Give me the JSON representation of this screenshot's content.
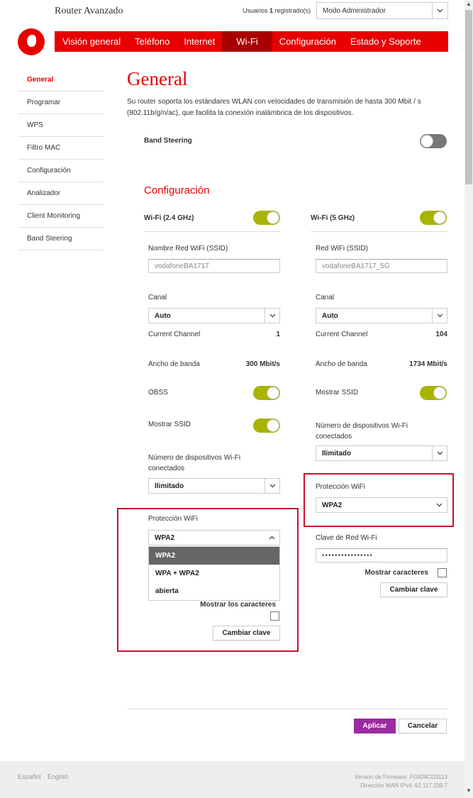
{
  "header": {
    "app_title": "Router Avanzado",
    "users_prefix": "Usuarios ",
    "users_count": "1",
    "users_suffix": " registrado(s)",
    "mode_select": "Modo Administrador"
  },
  "nav": {
    "items": [
      "Visión general",
      "Teléfono",
      "Internet",
      "Wi-Fi",
      "Configuración",
      "Estado y Soporte"
    ],
    "active_index": 3
  },
  "sidebar": {
    "items": [
      "General",
      "Programar",
      "WPS",
      "Filtro MAC",
      "Configuración",
      "Analizador",
      "Client Monitoring",
      "Band Steering"
    ],
    "active_index": 0
  },
  "main": {
    "title": "General",
    "intro": "Su router soporta los estándares WLAN con velocidades de transmisión de hasta 300 Mbit / s (802.11b/g/n/ac), que facilita la conexión inalámbrica de los dispositivos.",
    "band_steering": {
      "label": "Band Steering",
      "enabled": false
    },
    "config_title": "Configuración"
  },
  "wifi24": {
    "header": "Wi-Fi (2.4 GHz)",
    "enabled": true,
    "ssid_label": "Nombre Red WiFi (SSID)",
    "ssid_value": "vodafoneBA1717",
    "channel_label": "Canal",
    "channel_value": "Auto",
    "current_channel_label": "Current Channel",
    "current_channel_value": "1",
    "bandwidth_label": "Ancho de banda",
    "bandwidth_value": "300 Mbit/s",
    "obss_label": "OBSS",
    "obss_enabled": true,
    "show_ssid_label": "Mostrar SSID",
    "show_ssid_enabled": true,
    "devices_label": "Número de dispositivos Wi-Fi conectados",
    "devices_value": "Ilimitado",
    "protection_label": "Protección WiFi",
    "protection_value": "WPA2",
    "protection_options": [
      "WPA2",
      "WPA + WPA2",
      "abierta"
    ],
    "show_chars_label": "Mostrar los caracteres",
    "change_key_button": "Cambiar clave"
  },
  "wifi5": {
    "header": "Wi-Fi (5 GHz)",
    "enabled": true,
    "ssid_label": "Red WiFi (SSID)",
    "ssid_value": "vodafoneBA1717_5G",
    "channel_label": "Canal",
    "channel_value": "Auto",
    "current_channel_label": "Current Channel",
    "current_channel_value": "104",
    "bandwidth_label": "Ancho de banda",
    "bandwidth_value": "1734 Mbit/s",
    "show_ssid_label": "Mostrar SSID",
    "show_ssid_enabled": true,
    "devices_label": "Número de dispositivos Wi-Fi conectados",
    "devices_value": "Ilimitado",
    "protection_label": "Protección WiFi",
    "protection_value": "WPA2",
    "key_label": "Clave de Red Wi-Fi",
    "key_value": "••••••••••••••••",
    "show_chars_label": "Mostrar caracteres",
    "change_key_button": "Cambiar clave"
  },
  "actions": {
    "apply": "Aplicar",
    "cancel": "Cancelar"
  },
  "footer": {
    "languages": [
      "Español",
      "English"
    ],
    "firmware": "Version de Firmware: FG824CD3113",
    "wan_ip": "Dirección WAN IPv4: 62.117.239.7"
  },
  "colors": {
    "brand_red": "#e60000",
    "toggle_on": "#a8b400",
    "apply_purple": "#9c2aa0",
    "highlight": "#c8102e"
  },
  "icons": {
    "dropdown": "chevron-down-icon",
    "dropdown_open": "chevron-up-icon",
    "logo": "vodafone-logo-icon"
  }
}
